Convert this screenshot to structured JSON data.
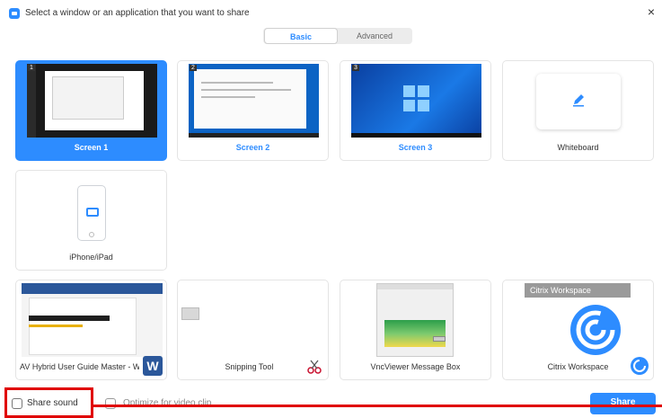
{
  "window": {
    "title": "Select a window or an application that you want to share",
    "close_icon": "×"
  },
  "tabs": [
    {
      "label": "Basic",
      "active": true
    },
    {
      "label": "Advanced",
      "active": false
    }
  ],
  "screens": [
    {
      "number": "1",
      "label": "Screen 1"
    },
    {
      "number": "2",
      "label": "Screen 2"
    },
    {
      "number": "3",
      "label": "Screen 3"
    }
  ],
  "whiteboard": {
    "label": "Whiteboard",
    "icon": "pen-icon"
  },
  "iphone": {
    "label": "iPhone/iPad",
    "icon": "airplay-icon"
  },
  "apps": [
    {
      "label": "AV Hybrid User Guide Master - W...",
      "badge": "W",
      "icon": "word-icon"
    },
    {
      "label": "Snipping Tool",
      "icon": "scissors-icon"
    },
    {
      "label": "VncViewer Message Box"
    },
    {
      "label": "Citrix Workspace",
      "header": "Citrix Workspace",
      "icon": "citrix-icon"
    }
  ],
  "footer": {
    "share_sound": {
      "label": "Share sound",
      "checked": false
    },
    "optimize": {
      "label": "Optimize for video clip",
      "checked": false
    },
    "share_button": "Share"
  },
  "colors": {
    "accent": "#2d8cff",
    "annotation": "#e00000"
  }
}
